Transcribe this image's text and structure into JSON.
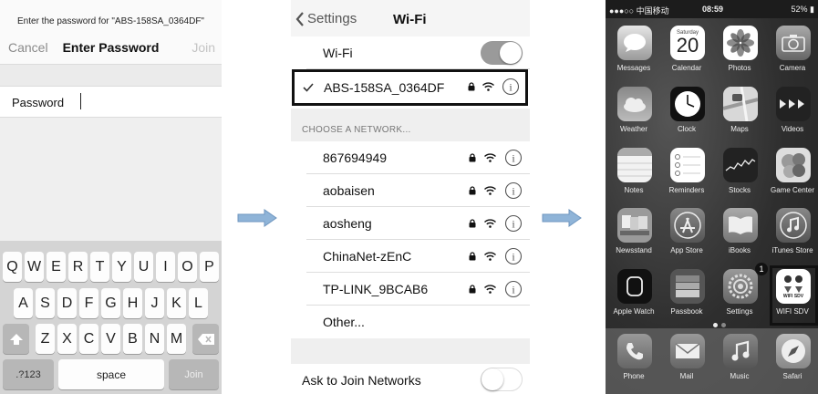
{
  "password_screen": {
    "prompt": "Enter the password for \"ABS-158SA_0364DF\"",
    "cancel_label": "Cancel",
    "title": "Enter Password",
    "join_label": "Join",
    "password_label": "Password",
    "password_value": "",
    "keyboard": {
      "row1": [
        "Q",
        "W",
        "E",
        "R",
        "T",
        "Y",
        "U",
        "I",
        "O",
        "P"
      ],
      "row2": [
        "A",
        "S",
        "D",
        "F",
        "G",
        "H",
        "J",
        "K",
        "L"
      ],
      "row3": [
        "Z",
        "X",
        "C",
        "V",
        "B",
        "N",
        "M"
      ],
      "numbers_key": ".?123",
      "space_key": "space",
      "join_key": "Join"
    }
  },
  "wifi_settings": {
    "back_label": "Settings",
    "title": "Wi-Fi",
    "wifi_label": "Wi-Fi",
    "wifi_on": true,
    "connected_network": "ABS-158SA_0364DF",
    "choose_header": "CHOOSE A NETWORK...",
    "networks": [
      "867694949",
      "aobaisen",
      "aosheng",
      "ChinaNet-zEnC",
      "TP-LINK_9BCAB6"
    ],
    "other_label": "Other...",
    "ask_to_join_label": "Ask to Join Networks",
    "ask_to_join_on": false,
    "toggle_on_color": "#9a9a9a",
    "toggle_off_color": "#e6e6e6"
  },
  "home_screen": {
    "status": {
      "carrier": "●●●○○ 中国移动",
      "time": "08:59",
      "battery": "52%"
    },
    "calendar_day": "Saturday",
    "calendar_date": "20",
    "apps": [
      "Messages",
      "Calendar",
      "Photos",
      "Camera",
      "Weather",
      "Clock",
      "Maps",
      "Videos",
      "Notes",
      "Reminders",
      "Stocks",
      "Game Center",
      "Newsstand",
      "App Store",
      "iBooks",
      "iTunes Store",
      "Apple Watch",
      "Passbook",
      "Settings",
      "WIFI SDV"
    ],
    "settings_badge": "1",
    "wifi_sdv_icon_text": "WIFI SDV",
    "dock": [
      "Phone",
      "Mail",
      "Music",
      "Safari"
    ]
  },
  "arrow_color": "#8fb4d8"
}
